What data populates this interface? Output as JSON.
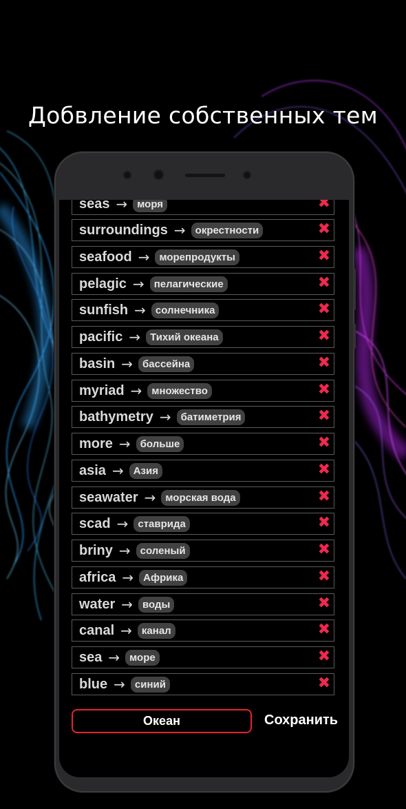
{
  "headline": "Добвление собственных тем",
  "partial_row": {
    "word": "seas",
    "translation": "моря"
  },
  "rows": [
    {
      "word": "surroundings",
      "translation": "окрестности"
    },
    {
      "word": "seafood",
      "translation": "морепродукты"
    },
    {
      "word": "pelagic",
      "translation": "пелагические"
    },
    {
      "word": "sunfish",
      "translation": "солнечника"
    },
    {
      "word": "pacific",
      "translation": "Тихий океана"
    },
    {
      "word": "basin",
      "translation": "бассейна"
    },
    {
      "word": "myriad",
      "translation": "множество"
    },
    {
      "word": "bathymetry",
      "translation": "батиметрия"
    },
    {
      "word": "more",
      "translation": "больше"
    },
    {
      "word": "asia",
      "translation": "Азия"
    },
    {
      "word": "seawater",
      "translation": "морская вода"
    },
    {
      "word": "scad",
      "translation": "ставрида"
    },
    {
      "word": "briny",
      "translation": "соленый"
    },
    {
      "word": "africa",
      "translation": "Африка"
    },
    {
      "word": "water",
      "translation": "воды"
    },
    {
      "word": "canal",
      "translation": "канал"
    },
    {
      "word": "sea",
      "translation": "море"
    },
    {
      "word": "blue",
      "translation": "синий"
    }
  ],
  "symbols": {
    "arrow": "→",
    "delete": "✖"
  },
  "footer": {
    "topic_label": "Океан",
    "save_label": "Сохранить"
  },
  "colors": {
    "accent_red": "#e8242c",
    "delete_red": "#ee2a4d",
    "chip_bg": "#414141"
  },
  "icons": {
    "delete": "close-x-icon",
    "arrow": "arrow-right-icon"
  }
}
